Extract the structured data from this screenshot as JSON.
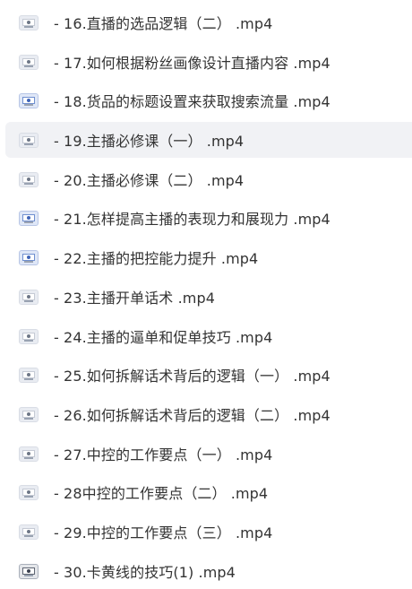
{
  "files": [
    {
      "name": "- 16.直播的选品逻辑（二） .mp4",
      "thumb": "video-thumbnail-icon"
    },
    {
      "name": "- 17.如何根据粉丝画像设计直播内容 .mp4",
      "thumb": "video-thumbnail-icon"
    },
    {
      "name": "- 18.货品的标题设置来获取搜索流量 .mp4",
      "thumb": "video-thumbnail-icon"
    },
    {
      "name": "- 19.主播必修课（一） .mp4",
      "thumb": "video-thumbnail-icon",
      "selected": true
    },
    {
      "name": "- 20.主播必修课（二） .mp4",
      "thumb": "video-thumbnail-icon"
    },
    {
      "name": "- 21.怎样提高主播的表现力和展现力 .mp4",
      "thumb": "video-thumbnail-icon"
    },
    {
      "name": "- 22.主播的把控能力提升 .mp4",
      "thumb": "video-thumbnail-icon"
    },
    {
      "name": "- 23.主播开单话术 .mp4",
      "thumb": "video-thumbnail-icon"
    },
    {
      "name": "- 24.主播的逼单和促单技巧 .mp4",
      "thumb": "video-thumbnail-icon"
    },
    {
      "name": "- 25.如何拆解话术背后的逻辑（一） .mp4",
      "thumb": "video-thumbnail-icon"
    },
    {
      "name": "- 26.如何拆解话术背后的逻辑（二） .mp4",
      "thumb": "video-thumbnail-icon"
    },
    {
      "name": "- 27.中控的工作要点（一） .mp4",
      "thumb": "video-thumbnail-icon"
    },
    {
      "name": "- 28中控的工作要点（二） .mp4",
      "thumb": "video-thumbnail-icon"
    },
    {
      "name": "- 29.中控的工作要点（三） .mp4",
      "thumb": "video-thumbnail-icon"
    },
    {
      "name": "- 30.卡黄线的技巧(1) .mp4",
      "thumb": "video-thumbnail-icon"
    }
  ],
  "colors": {
    "text": "#333333",
    "selected_row": "#f1f2f5"
  }
}
